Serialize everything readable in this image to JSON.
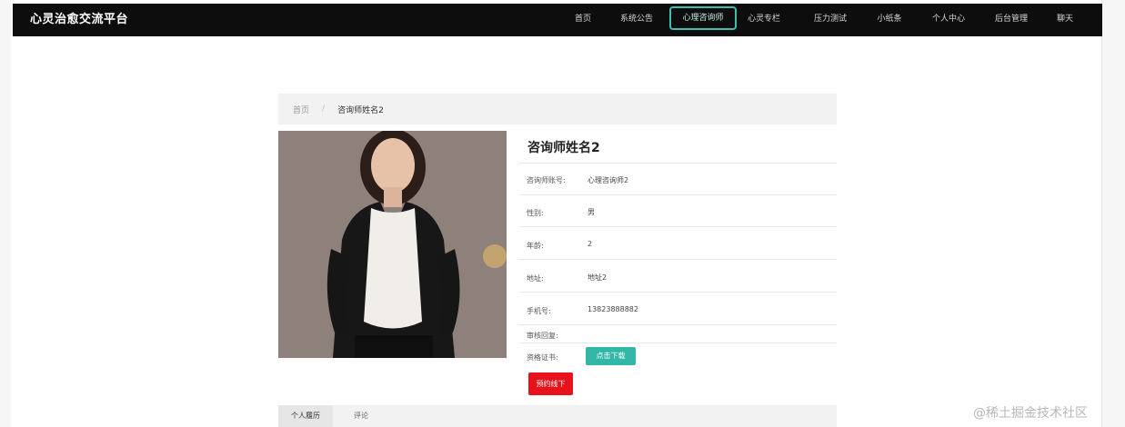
{
  "nav": {
    "brand": "心灵治愈交流平台",
    "items": [
      "首页",
      "系统公告",
      "心理咨询师",
      "心灵专栏",
      "压力测试",
      "小纸条",
      "个人中心",
      "后台管理",
      "聊天"
    ],
    "active_index": 2
  },
  "breadcrumb": {
    "home": "首页",
    "separator": "/",
    "current": "咨询师姓名2"
  },
  "counselor": {
    "name": "咨询师姓名2",
    "fields": [
      {
        "label": "咨询师账号:",
        "value": "心理咨询师2"
      },
      {
        "label": "性别:",
        "value": "男"
      },
      {
        "label": "年龄:",
        "value": "2"
      },
      {
        "label": "地址:",
        "value": "地址2"
      },
      {
        "label": "手机号:",
        "value": "13823888882"
      },
      {
        "label": "审核回复:",
        "value": ""
      },
      {
        "label": "资格证书:",
        "value": ""
      }
    ],
    "download_label": "点击下载",
    "book_label": "预约线下"
  },
  "tabs": [
    "个人履历",
    "评论"
  ],
  "watermark": "@稀土掘金技术社区",
  "colors": {
    "nav_bg": "#0d0d0d",
    "accent": "#3bbfb0",
    "danger": "#e8121b"
  }
}
